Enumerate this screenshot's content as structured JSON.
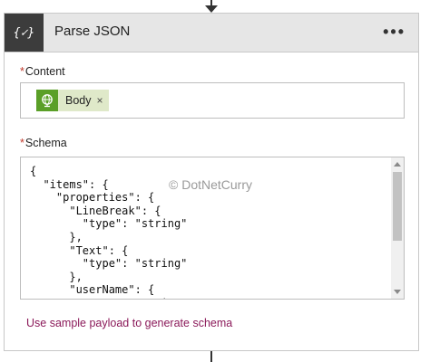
{
  "action": {
    "icon_text": "{✓}",
    "title": "Parse JSON",
    "more_label": "•••"
  },
  "content_field": {
    "label": "Content",
    "required_marker": "*",
    "token": {
      "label": "Body",
      "remove": "×",
      "icon": "globe-icon"
    }
  },
  "schema_field": {
    "label": "Schema",
    "required_marker": "*",
    "text": "{\n  \"items\": {\n    \"properties\": {\n      \"LineBreak\": {\n        \"type\": \"string\"\n      },\n      \"Text\": {\n        \"type\": \"string\"\n      },\n      \"userName\": {\n        \"type\": \"string\"",
    "watermark": "© DotNetCurry"
  },
  "sample_link": "Use sample payload to generate schema",
  "colors": {
    "header_bg": "#e6e6e6",
    "icon_bg": "#3c3c3c",
    "token_bg": "#dfe9c9",
    "token_icon_bg": "#5a9f27",
    "link": "#8b1a5a",
    "required": "#c0392b"
  }
}
